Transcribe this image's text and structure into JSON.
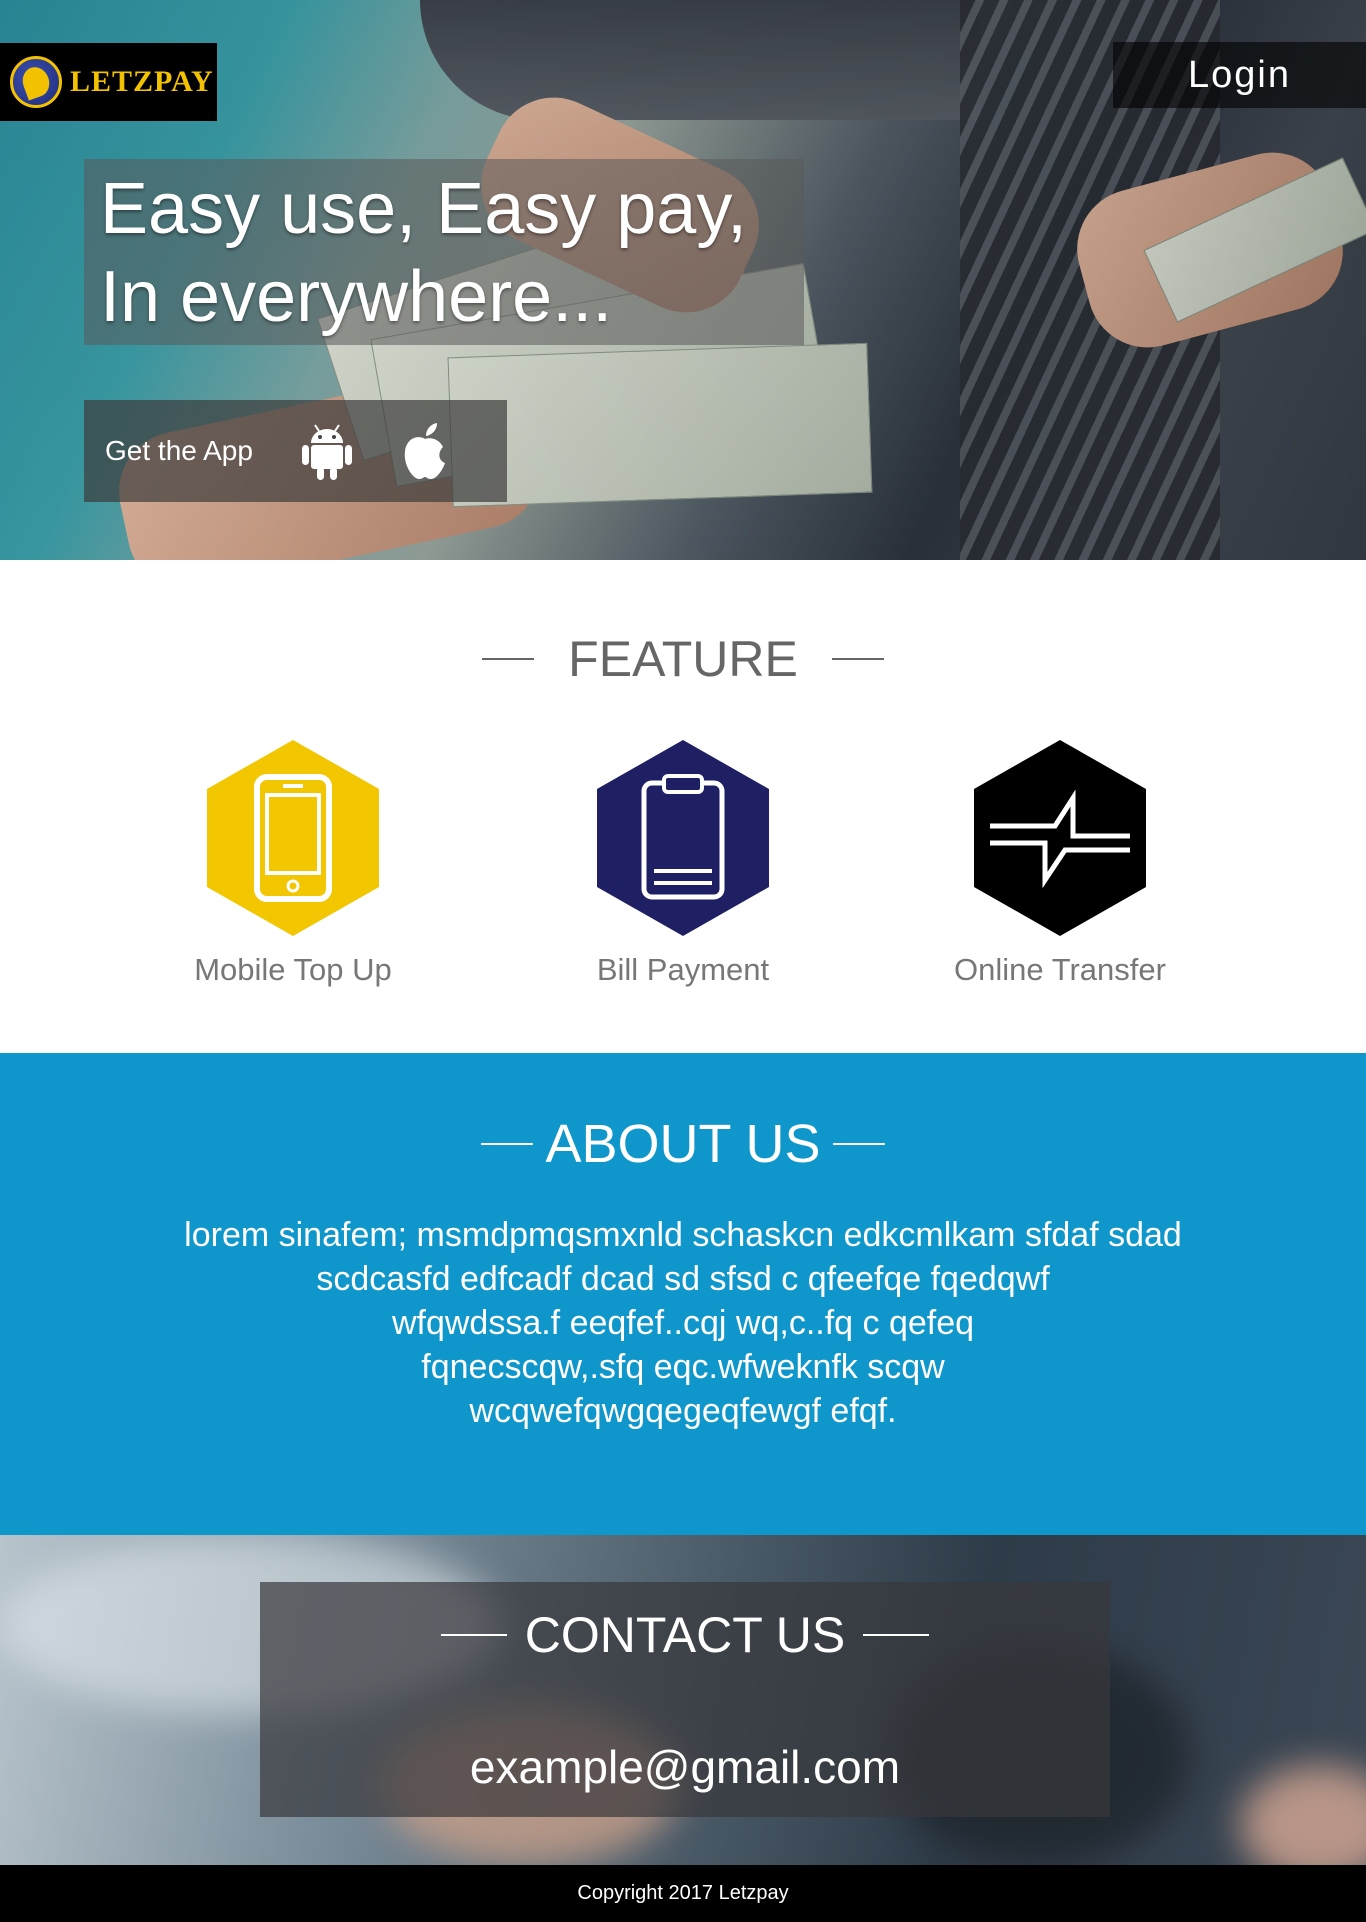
{
  "brand": {
    "name": "LETZPAY"
  },
  "header": {
    "login_label": "Login"
  },
  "hero": {
    "headline_line1": "Easy use, Easy pay,",
    "headline_line2": "In everywhere...",
    "get_app_label": "Get the App"
  },
  "features": {
    "title": "FEATURE",
    "items": [
      {
        "label": "Mobile Top Up",
        "icon": "mobile-phone-icon",
        "color": "#f2c600"
      },
      {
        "label": "Bill Payment",
        "icon": "clipboard-icon",
        "color": "#1f2063"
      },
      {
        "label": "Online Transfer",
        "icon": "transfer-icon",
        "color": "#000000"
      }
    ]
  },
  "about": {
    "title": "ABOUT US",
    "lines": [
      "lorem sinafem; msmdpmqsmxnld schaskcn edkcmlkam sfdaf sdad",
      "scdcasfd edfcadf dcad sd sfsd c qfeefqe fqedqwf",
      "wfqwdssa.f eeqfef..cqj wq,c..fq c qefeq",
      "fqnecscqw,.sfq eqc.wfweknfk scqw",
      "wcqwefqwgqegeqfewgf efqf."
    ],
    "background": "#0f97cc"
  },
  "contact": {
    "title": "CONTACT US",
    "email": "example@gmail.com"
  },
  "footer": {
    "copyright": "Copyright 2017 Letzpay"
  }
}
